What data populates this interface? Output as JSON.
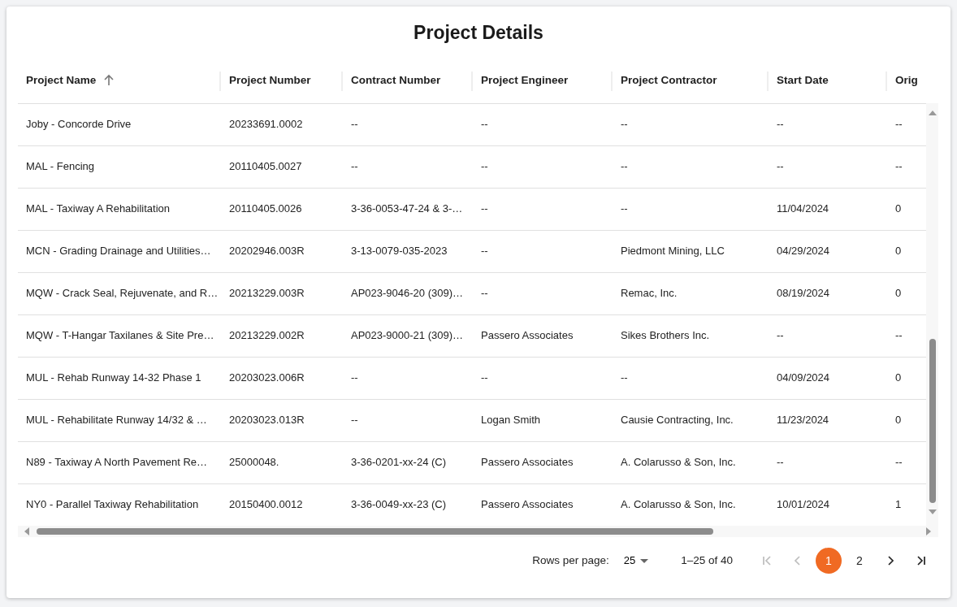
{
  "title": "Project Details",
  "table": {
    "columns": [
      {
        "label": "Project Name",
        "sorted": true
      },
      {
        "label": "Project Number",
        "sorted": false
      },
      {
        "label": "Contract Number",
        "sorted": false
      },
      {
        "label": "Project Engineer",
        "sorted": false
      },
      {
        "label": "Project Contractor",
        "sorted": false
      },
      {
        "label": "Start Date",
        "sorted": false
      },
      {
        "label": "Orig",
        "sorted": false
      }
    ],
    "rows": [
      [
        "Joby - Concorde Drive",
        "20233691.0002",
        "--",
        "--",
        "--",
        "--",
        "--"
      ],
      [
        "MAL - Fencing",
        "20110405.0027",
        "--",
        "--",
        "--",
        "--",
        "--"
      ],
      [
        "MAL - Taxiway A Rehabilitation",
        "20110405.0026",
        "3-36-0053-47-24 & 3-…",
        "--",
        "--",
        "11/04/2024",
        "0"
      ],
      [
        "MCN - Grading Drainage and Utilities…",
        "20202946.003R",
        "3-13-0079-035-2023",
        "--",
        "Piedmont Mining, LLC",
        "04/29/2024",
        "0"
      ],
      [
        "MQW - Crack Seal, Rejuvenate, and R…",
        "20213229.003R",
        "AP023-9046-20 (309)…",
        "--",
        "Remac, Inc.",
        "08/19/2024",
        "0"
      ],
      [
        "MQW - T-Hangar Taxilanes & Site Pre…",
        "20213229.002R",
        "AP023-9000-21 (309)…",
        "Passero Associates",
        "Sikes Brothers Inc.",
        "--",
        "--"
      ],
      [
        "MUL - Rehab Runway 14-32 Phase 1",
        "20203023.006R",
        "--",
        "--",
        "--",
        "04/09/2024",
        "0"
      ],
      [
        "MUL - Rehabilitate Runway 14/32 & …",
        "20203023.013R",
        "--",
        "Logan Smith",
        "Causie Contracting, Inc.",
        "11/23/2024",
        "0"
      ],
      [
        "N89 - Taxiway A North Pavement Re…",
        "25000048.",
        "3-36-0201-xx-24 (C)",
        "Passero Associates",
        "A. Colarusso & Son, Inc.",
        "--",
        "--"
      ],
      [
        "NY0 - Parallel Taxiway Rehabilitation",
        "20150400.0012",
        "3-36-0049-xx-23 (C)",
        "Passero Associates",
        "A. Colarusso & Son, Inc.",
        "10/01/2024",
        "1"
      ]
    ]
  },
  "pagination": {
    "rows_per_page_label": "Rows per page:",
    "rows_per_page": "25",
    "range": "1–25 of 40",
    "first": {
      "disabled": true
    },
    "previous": {
      "disabled": true
    },
    "pages": [
      {
        "label": "1",
        "selected": true
      },
      {
        "label": "2",
        "selected": false
      }
    ],
    "next": {
      "disabled": false
    },
    "last": {
      "disabled": false
    }
  }
}
